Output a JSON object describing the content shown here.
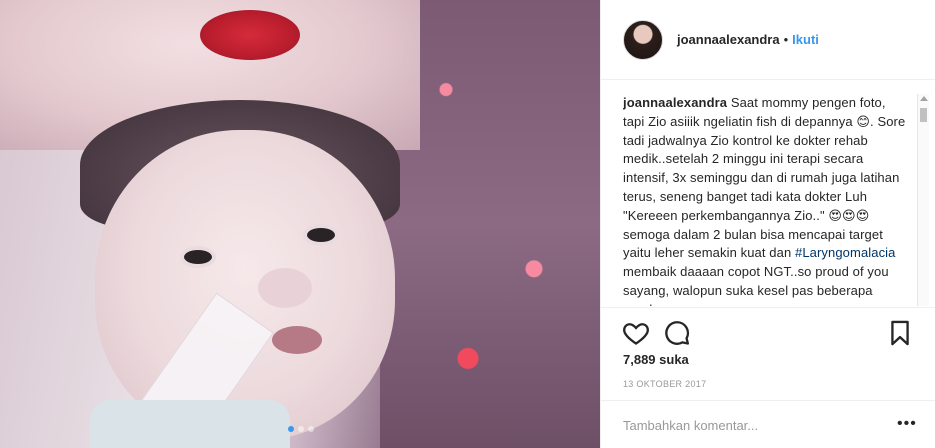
{
  "post": {
    "username": "joannaalexandra",
    "separator": "•",
    "follow_label": "Ikuti",
    "caption_user": "joannaalexandra",
    "caption_text_1": " Saat mommy pengen foto, tapi Zio asiiik ngeliatin fish di depannya 😊. Sore tadi jadwalnya Zio kontrol ke dokter rehab medik..setelah 2 minggu ini terapi secara intensif, 3x seminggu dan di rumah juga latihan terus, seneng banget tadi kata dokter Luh \"Kereeen perkembangannya Zio..\" 😍😍😍 semoga dalam 2 bulan bisa mencapai target yaitu leher semakin kuat dan ",
    "caption_hashtag": "#Laryngomalacia",
    "caption_text_2": " membaik daaaan copot NGT..so proud of you sayang, walopun suka kesel pas beberapa gerakan",
    "likes": "7,889 suka",
    "date": "13 OKTOBER 2017",
    "comment_placeholder": "Tambahkan komentar...",
    "more_label": "•••",
    "carousel": {
      "count": 3,
      "active_index": 0
    }
  }
}
